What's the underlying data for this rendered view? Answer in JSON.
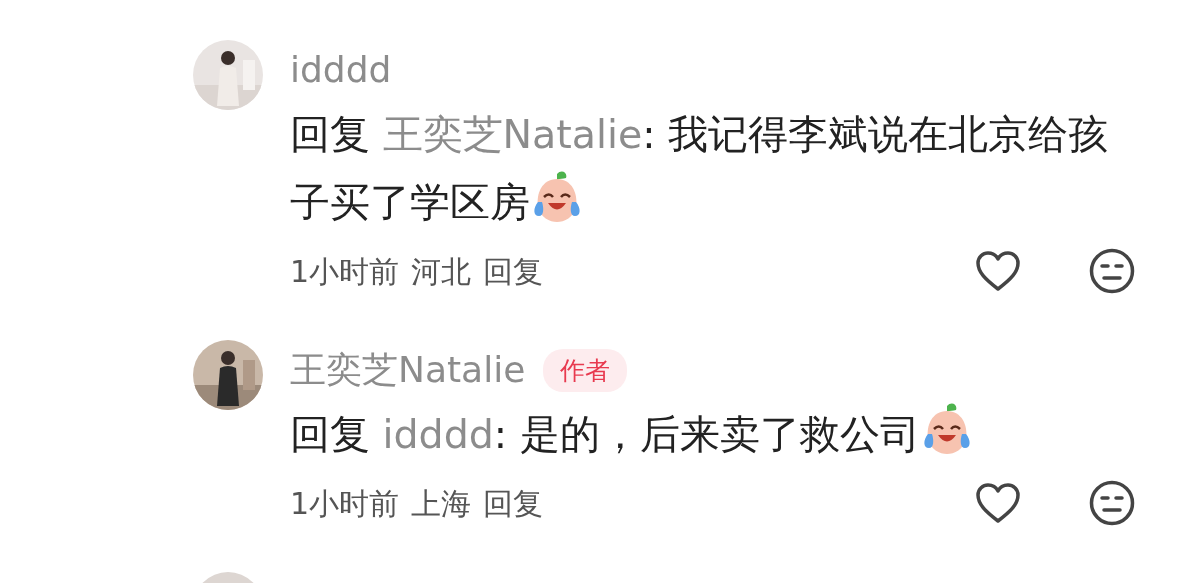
{
  "comments": [
    {
      "username": "idddd",
      "reply_label": "回复",
      "reply_to": "王奕芝Natalie",
      "text": ": 我记得李斌说在北京给孩子买了学区房",
      "time": "1小时前",
      "location": "河北",
      "reply_action": "回复",
      "liked": false
    },
    {
      "username": "王奕芝Natalie",
      "author_badge": "作者",
      "reply_label": "回复",
      "reply_to": "idddd",
      "text": ": 是的，后来卖了救公司",
      "time": "1小时前",
      "location": "上海",
      "reply_action": "回复",
      "liked": false
    }
  ]
}
